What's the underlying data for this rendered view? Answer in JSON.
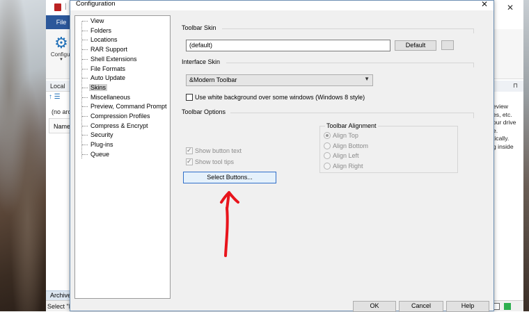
{
  "background_app": {
    "file_tab": "File",
    "config_button_label": "Configur",
    "local_label": "Local",
    "address_text": "(no arc",
    "name_column": "Name",
    "side_panel_text": "eview\nes, etc.\nour drive\ne.\ntically.\ng inside",
    "archive_tab": "Archive",
    "status_text": "Select \"N"
  },
  "dialog": {
    "title": "Configuration",
    "tree": {
      "items": [
        {
          "label": "View"
        },
        {
          "label": "Folders"
        },
        {
          "label": "Locations"
        },
        {
          "label": "RAR Support"
        },
        {
          "label": "Shell Extensions"
        },
        {
          "label": "File Formats"
        },
        {
          "label": "Auto Update"
        },
        {
          "label": "Skins",
          "selected": true
        },
        {
          "label": "Miscellaneous"
        },
        {
          "label": "Preview, Command Prompt"
        },
        {
          "label": "Compression Profiles"
        },
        {
          "label": "Compress & Encrypt"
        },
        {
          "label": "Security"
        },
        {
          "label": "Plug-ins"
        },
        {
          "label": "Queue"
        }
      ]
    },
    "toolbar_skin": {
      "header": "Toolbar Skin",
      "value": "(default)",
      "default_button": "Default"
    },
    "interface_skin": {
      "header": "Interface Skin",
      "selected": "&Modern Toolbar",
      "white_bg_checkbox": "Use white background over some windows (Windows 8 style)",
      "white_bg_checked": false
    },
    "toolbar_options": {
      "header": "Toolbar Options",
      "show_button_text": "Show button text",
      "show_tool_tips": "Show tool tips",
      "select_buttons": "Select Buttons...",
      "alignment": {
        "legend": "Toolbar Alignment",
        "options": [
          "Align Top",
          "Align Bottom",
          "Align Left",
          "Align Right"
        ],
        "selected": "Align Top"
      }
    },
    "footer": {
      "ok": "OK",
      "cancel": "Cancel",
      "help": "Help"
    },
    "annotation_color": "#e8141c"
  }
}
